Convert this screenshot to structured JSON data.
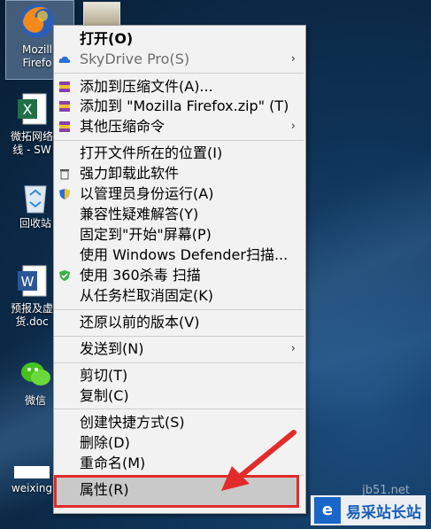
{
  "desktop": {
    "icons": [
      {
        "label1": "Mozill",
        "label2": "Firefo"
      },
      {
        "label1": "微拓网络",
        "label2": "线 - SW"
      },
      {
        "label1": "回收站",
        "label2": ""
      },
      {
        "label1": "预报及虚",
        "label2": "货.doc"
      },
      {
        "label1": "微信",
        "label2": ""
      },
      {
        "label1": "weixing",
        "label2": ""
      }
    ]
  },
  "menu": {
    "items": [
      {
        "label": "打开(O)"
      },
      {
        "label": "SkyDrive Pro(S)"
      },
      {
        "label": "添加到压缩文件(A)..."
      },
      {
        "label": "添加到 \"Mozilla Firefox.zip\" (T)"
      },
      {
        "label": "其他压缩命令"
      },
      {
        "label": "打开文件所在的位置(I)"
      },
      {
        "label": "强力卸载此软件"
      },
      {
        "label": "以管理员身份运行(A)"
      },
      {
        "label": "兼容性疑难解答(Y)"
      },
      {
        "label": "固定到\"开始\"屏幕(P)"
      },
      {
        "label": "使用 Windows Defender扫描..."
      },
      {
        "label": "使用 360杀毒 扫描"
      },
      {
        "label": "从任务栏取消固定(K)"
      },
      {
        "label": "还原以前的版本(V)"
      },
      {
        "label": "发送到(N)"
      },
      {
        "label": "剪切(T)"
      },
      {
        "label": "复制(C)"
      },
      {
        "label": "创建快捷方式(S)"
      },
      {
        "label": "删除(D)"
      },
      {
        "label": "重命名(M)"
      },
      {
        "label": "属性(R)"
      }
    ]
  },
  "watermark": {
    "text": "易采站长站",
    "url": "jb51.net"
  },
  "colors": {
    "highlight": "#e22b2b",
    "menu_bg": "#f2f2f2"
  }
}
